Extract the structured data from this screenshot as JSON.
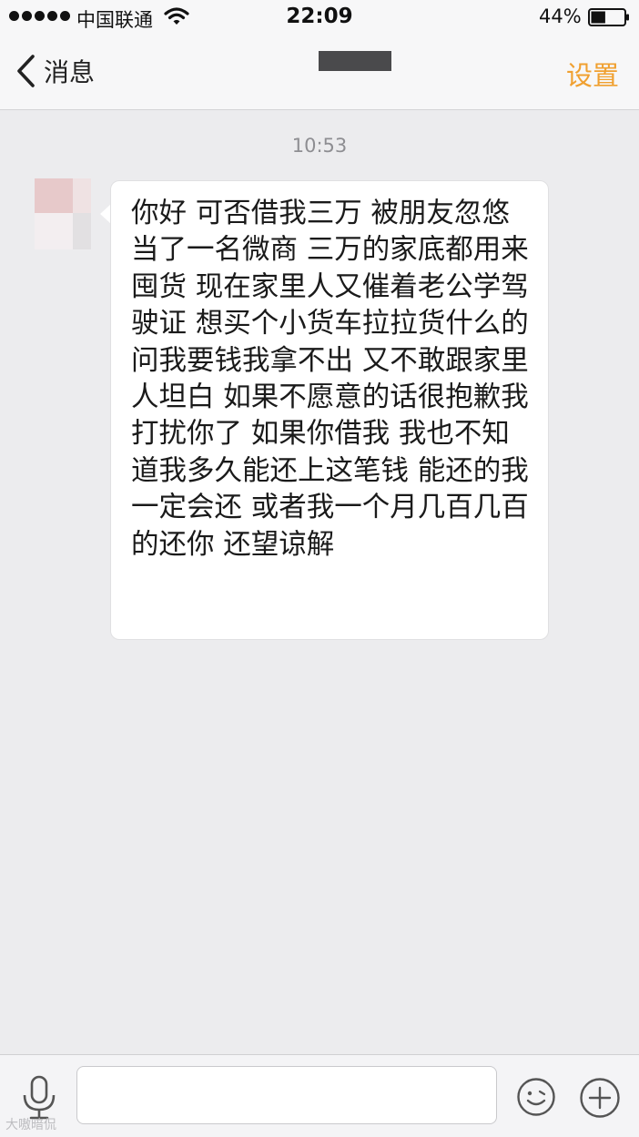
{
  "status_bar": {
    "carrier": "中国联通",
    "time": "22:09",
    "battery_percent": "44%",
    "battery_level": 0.44
  },
  "nav": {
    "back_label": "消息",
    "settings_label": "设置",
    "accent_color": "#f0a030"
  },
  "chat": {
    "timestamp": "10:53",
    "messages": [
      {
        "side": "incoming",
        "text": "你好 可否借我三万 被朋友忽悠当了一名微商 三万的家底都用来囤货 现在家里人又催着老公学驾驶证 想买个小货车拉拉货什么的 问我要钱我拿不出 又不敢跟家里人坦白 如果不愿意的话很抱歉我打扰你了 如果你借我 我也不知道我多久能还上这笔钱 能还的我一定会还 或者我一个月几百几百的还你 还望谅解"
      }
    ]
  },
  "input_bar": {
    "value": "",
    "icons": [
      "microphone-icon",
      "emoji-icon",
      "plus-icon"
    ]
  },
  "watermark": "大嗷暗侃"
}
